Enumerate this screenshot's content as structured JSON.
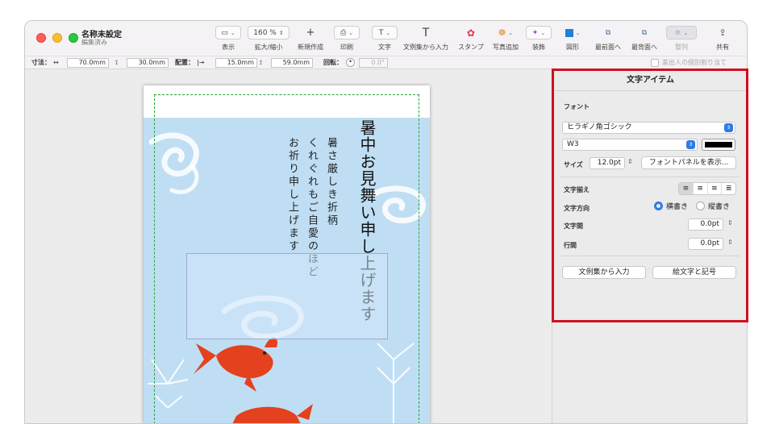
{
  "window": {
    "doc_title": "名称未設定",
    "doc_subtitle": "編集済み"
  },
  "toolbar": {
    "view_label": "表示",
    "zoom_value": "160 %",
    "zoom_label": "拡大/縮小",
    "new_label": "新規作成",
    "print_label": "印刷",
    "text_label": "文字",
    "text_from_examples_label": "文例集から入力",
    "stamp_label": "スタンプ",
    "add_photo_label": "写真追加",
    "decoration_label": "装飾",
    "shape_label": "図形",
    "bring_front_label": "最前面へ",
    "send_back_label": "最背面へ",
    "arrange_label": "整列",
    "share_label": "共有"
  },
  "optionbar": {
    "size_label": "寸法：",
    "width_value": "70.0mm",
    "height_value": "30.0mm",
    "position_label": "配置：",
    "x_value": "15.0mm",
    "y_value": "59.0mm",
    "rotation_label": "回転：",
    "rotation_value": "0.0°",
    "individual_label": "差出人の個別割り当て"
  },
  "card": {
    "title_text": "暑中お見舞い申し上げます",
    "line1": "暑さ厳しき折柄",
    "line2": "くれぐれもご自愛のほど",
    "line3": "お祈り申し上げます"
  },
  "inspector": {
    "heading": "文字アイテム",
    "font_label": "フォント",
    "font_family": "ヒラギノ角ゴシック",
    "font_weight": "W3",
    "size_label": "サイズ",
    "size_value": "12.0pt",
    "font_panel_button": "フォントパネルを表示...",
    "align_label": "文字揃え",
    "direction_label": "文字方向",
    "horizontal_label": "横書き",
    "vertical_label": "縦書き",
    "char_spacing_label": "文字間",
    "char_spacing_value": "0.0pt",
    "line_spacing_label": "行間",
    "line_spacing_value": "0.0pt",
    "examples_button": "文例集から入力",
    "emoji_button": "絵文字と記号",
    "text_color": "#000000"
  }
}
